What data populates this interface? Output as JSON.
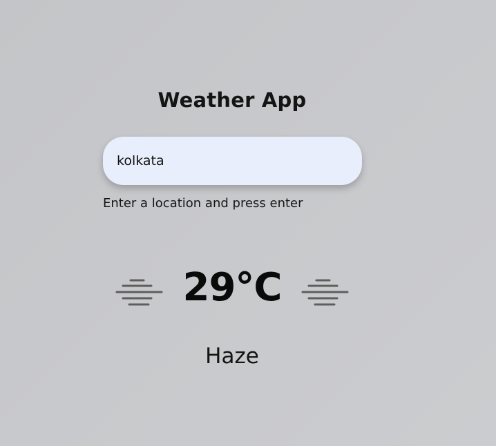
{
  "app": {
    "title": "Weather App"
  },
  "search": {
    "value": "kolkata",
    "hint": "Enter a location and press enter"
  },
  "weather": {
    "temperature": "29°C",
    "condition": "Haze",
    "icon_left": "haze-icon",
    "icon_right": "haze-icon"
  },
  "colors": {
    "background": "#c6c7ca",
    "input_background": "#e8eefb",
    "text": "#111111",
    "icon_stroke": "#5e5e5e"
  }
}
